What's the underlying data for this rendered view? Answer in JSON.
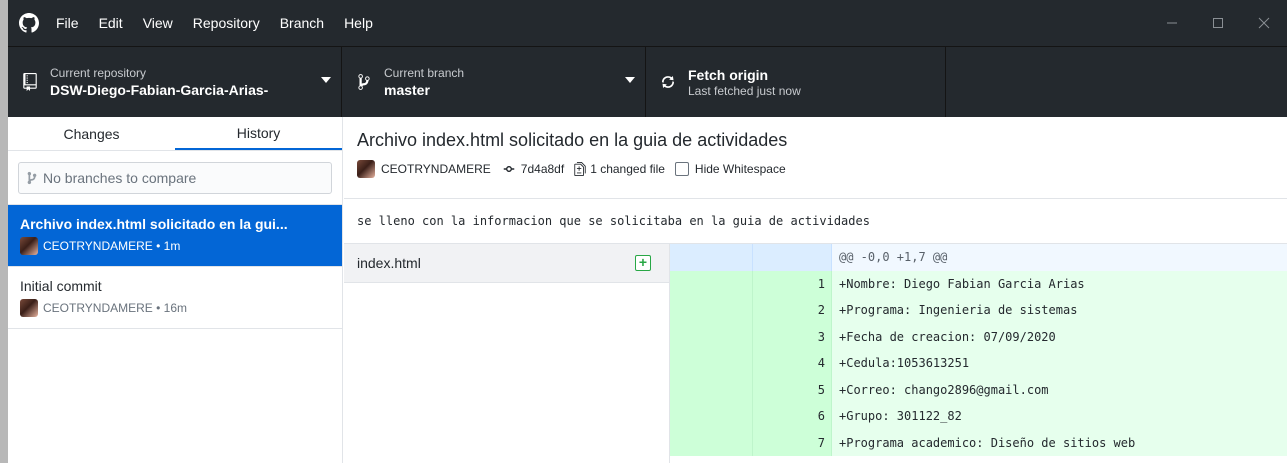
{
  "menu": [
    "File",
    "Edit",
    "View",
    "Repository",
    "Branch",
    "Help"
  ],
  "toolbar": {
    "repo_label": "Current repository",
    "repo_value": "DSW-Diego-Fabian-Garcia-Arias-",
    "branch_label": "Current branch",
    "branch_value": "master",
    "fetch_label": "Fetch origin",
    "fetch_sub": "Last fetched just now"
  },
  "sidebar": {
    "tabs": [
      "Changes",
      "History"
    ],
    "active_tab": "History",
    "compare_placeholder": "No branches to compare",
    "commits": [
      {
        "title": "Archivo index.html solicitado en la gui...",
        "meta": "CEOTRYNDAMERE • 1m"
      },
      {
        "title": "Initial commit",
        "meta": "CEOTRYNDAMERE • 16m"
      }
    ]
  },
  "commit": {
    "summary": "Archivo index.html solicitado en la guia de actividades",
    "author": "CEOTRYNDAMERE",
    "sha": "7d4a8df",
    "changed_files": "1 changed file",
    "hide_whitespace": "Hide Whitespace",
    "description": "se lleno con la informacion que se solicitaba en la guia de actividades"
  },
  "files": [
    {
      "name": "index.html",
      "status": "+"
    }
  ],
  "diff": {
    "hunk": "@@ -0,0 +1,7 @@",
    "lines": [
      {
        "n": "1",
        "text": "+Nombre: Diego Fabian Garcia Arias"
      },
      {
        "n": "2",
        "text": "+Programa: Ingenieria de sistemas"
      },
      {
        "n": "3",
        "text": "+Fecha de creacion: 07/09/2020"
      },
      {
        "n": "4",
        "text": "+Cedula:1053613251"
      },
      {
        "n": "5",
        "text": "+Correo: chango2896@gmail.com"
      },
      {
        "n": "6",
        "text": "+Grupo: 301122_82"
      },
      {
        "n": "7",
        "text": "+Programa academico: Diseño de sitios web"
      }
    ]
  },
  "colors": {
    "accent": "#0366d6",
    "titlebar": "#24292e",
    "added": "#e6ffed"
  }
}
